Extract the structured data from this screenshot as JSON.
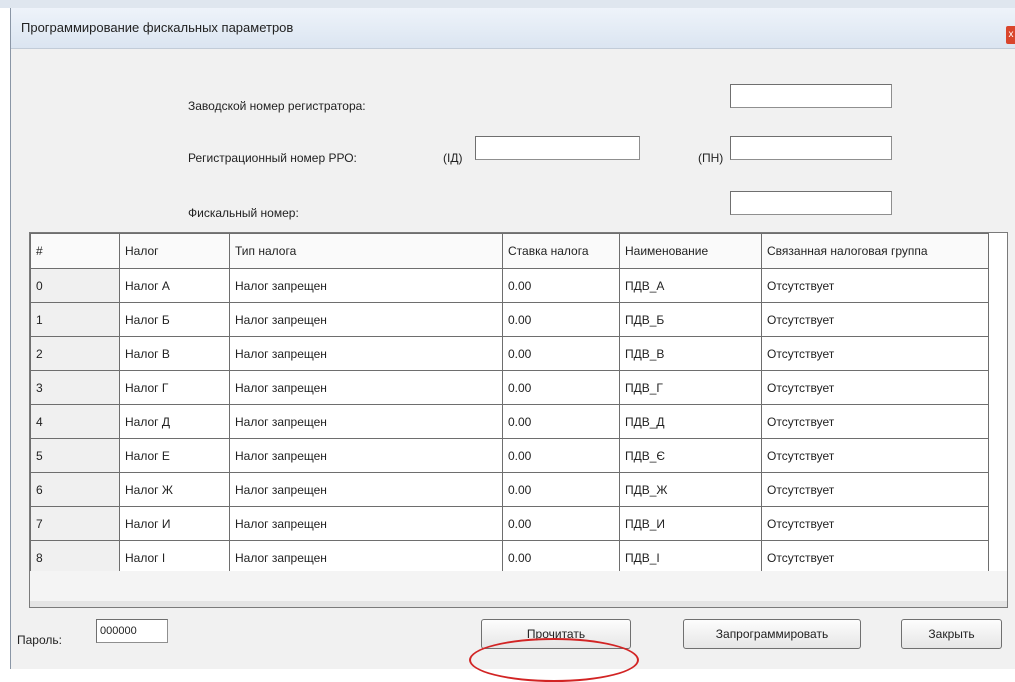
{
  "window": {
    "title": "Программирование фискальных параметров",
    "close_glyph": "x"
  },
  "form": {
    "serial_label": "Заводской номер регистратора:",
    "serial_value": "",
    "reg_label": "Регистрационный номер РРО:",
    "id_label": "(ІД)",
    "id_value": "",
    "pn_label": "(ПН)",
    "pn_value": "",
    "fiscal_label": "Фискальный номер:",
    "fiscal_value": ""
  },
  "table": {
    "columns": [
      "#",
      "Налог",
      "Тип налога",
      "Ставка налога",
      "Наименование",
      "Связанная налоговая группа"
    ],
    "rows": [
      [
        "0",
        "Налог А",
        "Налог запрещен",
        "0.00",
        "ПДВ_А",
        "Отсутствует"
      ],
      [
        "1",
        "Налог Б",
        "Налог запрещен",
        "0.00",
        "ПДВ_Б",
        "Отсутствует"
      ],
      [
        "2",
        "Налог В",
        "Налог запрещен",
        "0.00",
        "ПДВ_В",
        "Отсутствует"
      ],
      [
        "3",
        "Налог Г",
        "Налог запрещен",
        "0.00",
        "ПДВ_Г",
        "Отсутствует"
      ],
      [
        "4",
        "Налог Д",
        "Налог запрещен",
        "0.00",
        "ПДВ_Д",
        "Отсутствует"
      ],
      [
        "5",
        "Налог Е",
        "Налог запрещен",
        "0.00",
        "ПДВ_Є",
        "Отсутствует"
      ],
      [
        "6",
        "Налог Ж",
        "Налог запрещен",
        "0.00",
        "ПДВ_Ж",
        "Отсутствует"
      ],
      [
        "7",
        "Налог И",
        "Налог запрещен",
        "0.00",
        "ПДВ_И",
        "Отсутствует"
      ],
      [
        "8",
        "Налог І",
        "Налог запрещен",
        "0.00",
        "ПДВ_І",
        "Отсутствует"
      ]
    ]
  },
  "footer": {
    "password_label": "Пароль:",
    "password_value": "000000",
    "read_button": "Прочитать",
    "program_button": "Запрограммировать",
    "close_button": "Закрыть"
  },
  "colors": {
    "highlight_circle": "#d22424",
    "close_button_bg": "#d9452c"
  }
}
